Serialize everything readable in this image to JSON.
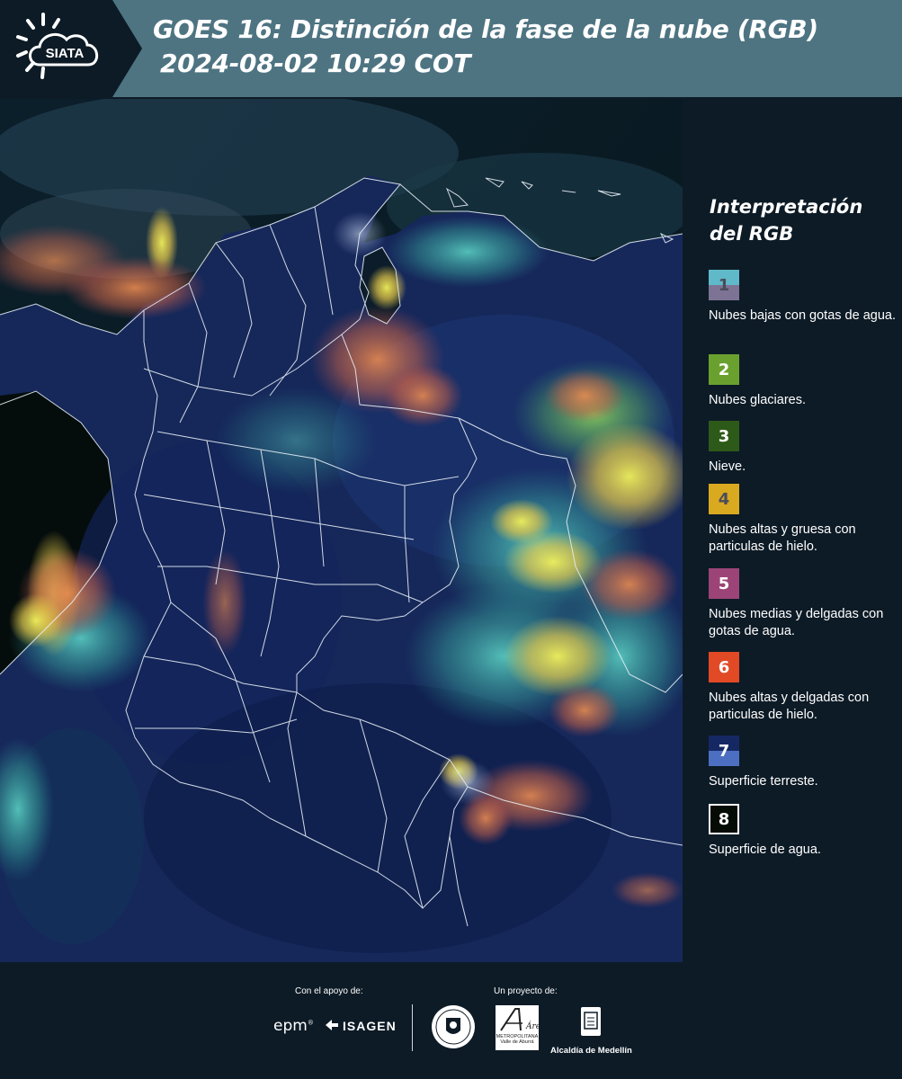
{
  "header": {
    "logo_text": "SIATA",
    "title_line1": "GOES 16: Distinción de la fase de la nube (RGB)",
    "title_line2": "2024-08-02 10:29 COT"
  },
  "map": {
    "icon": "satellite-rgb-map-colombia"
  },
  "legend": {
    "title": "Interpretación del RGB",
    "items": [
      {
        "number": "1",
        "label": "Nubes bajas con gotas de agua.",
        "color_top": "#5fb9c9",
        "color_bottom": "#7d7394"
      },
      {
        "number": "2",
        "label": "Nubes glaciares.",
        "color": "#6aa12e"
      },
      {
        "number": "3",
        "label": "Nieve.",
        "color": "#2e5a19"
      },
      {
        "number": "4",
        "label": "Nubes altas y gruesa con particulas de hielo.",
        "color": "#d9a91f"
      },
      {
        "number": "5",
        "label": "Nubes medias y delgadas con gotas de agua.",
        "color": "#9c4477"
      },
      {
        "number": "6",
        "label": "Nubes altas y delgadas con particulas de hielo.",
        "color": "#e24a26"
      },
      {
        "number": "7",
        "label": "Superficie terreste.",
        "color_top": "#152864",
        "color_bottom": "#4c6fc2"
      },
      {
        "number": "8",
        "label": "Superficie de agua.",
        "color": "#050c06"
      }
    ]
  },
  "footer": {
    "support_caption": "Con el apoyo de:",
    "project_caption": "Un proyecto de:",
    "epm": "epm",
    "isagen": "ISAGEN",
    "amva_script": "Área",
    "amva_line1": "METROPOLITANA",
    "amva_line2": "Valle de Aburrá",
    "alcaldia": "Alcaldía de Medellín"
  }
}
